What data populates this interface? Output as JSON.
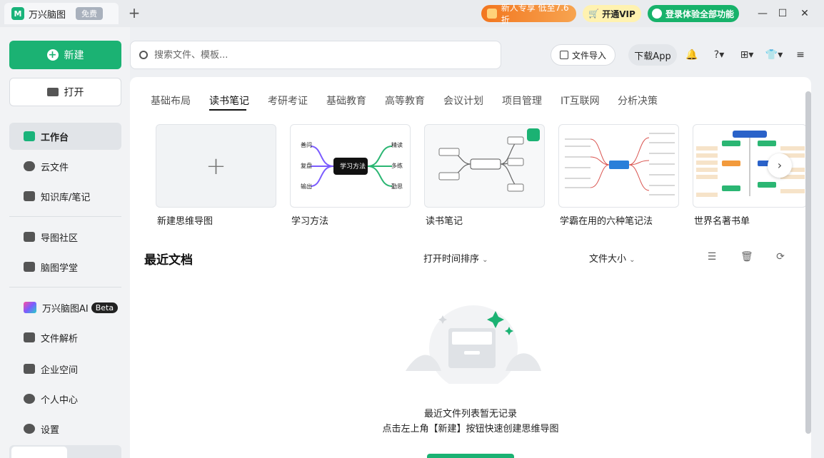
{
  "titlebar": {
    "app_name": "万兴脑图",
    "free_badge": "免费",
    "new_tab": "+",
    "promo": "新人专享 低至7.6折",
    "vip": "开通VIP",
    "login": "登录体验全部功能",
    "minimize": "—",
    "maximize": "☐",
    "close": "✕"
  },
  "sidebar": {
    "new_label": "新建",
    "open_label": "打开",
    "items": [
      {
        "label": "工作台"
      },
      {
        "label": "云文件"
      },
      {
        "label": "知识库/笔记"
      },
      {
        "label": "导图社区"
      },
      {
        "label": "脑图学堂"
      },
      {
        "label": "万兴脑图AI",
        "badge": "Beta"
      },
      {
        "label": "文件解析"
      },
      {
        "label": "企业空间"
      },
      {
        "label": "个人中心"
      },
      {
        "label": "设置"
      }
    ]
  },
  "topbar": {
    "search_placeholder": "搜索文件、模板...",
    "import_label": "文件导入",
    "download_label": "下载App"
  },
  "categories": [
    "基础布局",
    "读书笔记",
    "考研考证",
    "基础教育",
    "高等教育",
    "会议计划",
    "项目管理",
    "IT互联网",
    "分析决策"
  ],
  "active_category": "读书笔记",
  "templates": [
    {
      "label": "新建思维导图"
    },
    {
      "label": "学习方法",
      "center": "学习方法",
      "left": [
        "善问",
        "复盘",
        "输出"
      ],
      "right": [
        "精读",
        "多练",
        "勤思"
      ]
    },
    {
      "label": "读书笔记"
    },
    {
      "label": "学霸在用的六种笔记法"
    },
    {
      "label": "世界名著书单"
    }
  ],
  "recent": {
    "title": "最近文档",
    "sort_time": "打开时间排序",
    "sort_size": "文件大小",
    "empty_line1": "最近文件列表暂无记录",
    "empty_line2": "点击左上角【新建】按钮快速创建思维导图"
  },
  "colors": {
    "accent": "#1bb273",
    "promo": "#f2761f",
    "vip_bg": "#fff2b0"
  }
}
